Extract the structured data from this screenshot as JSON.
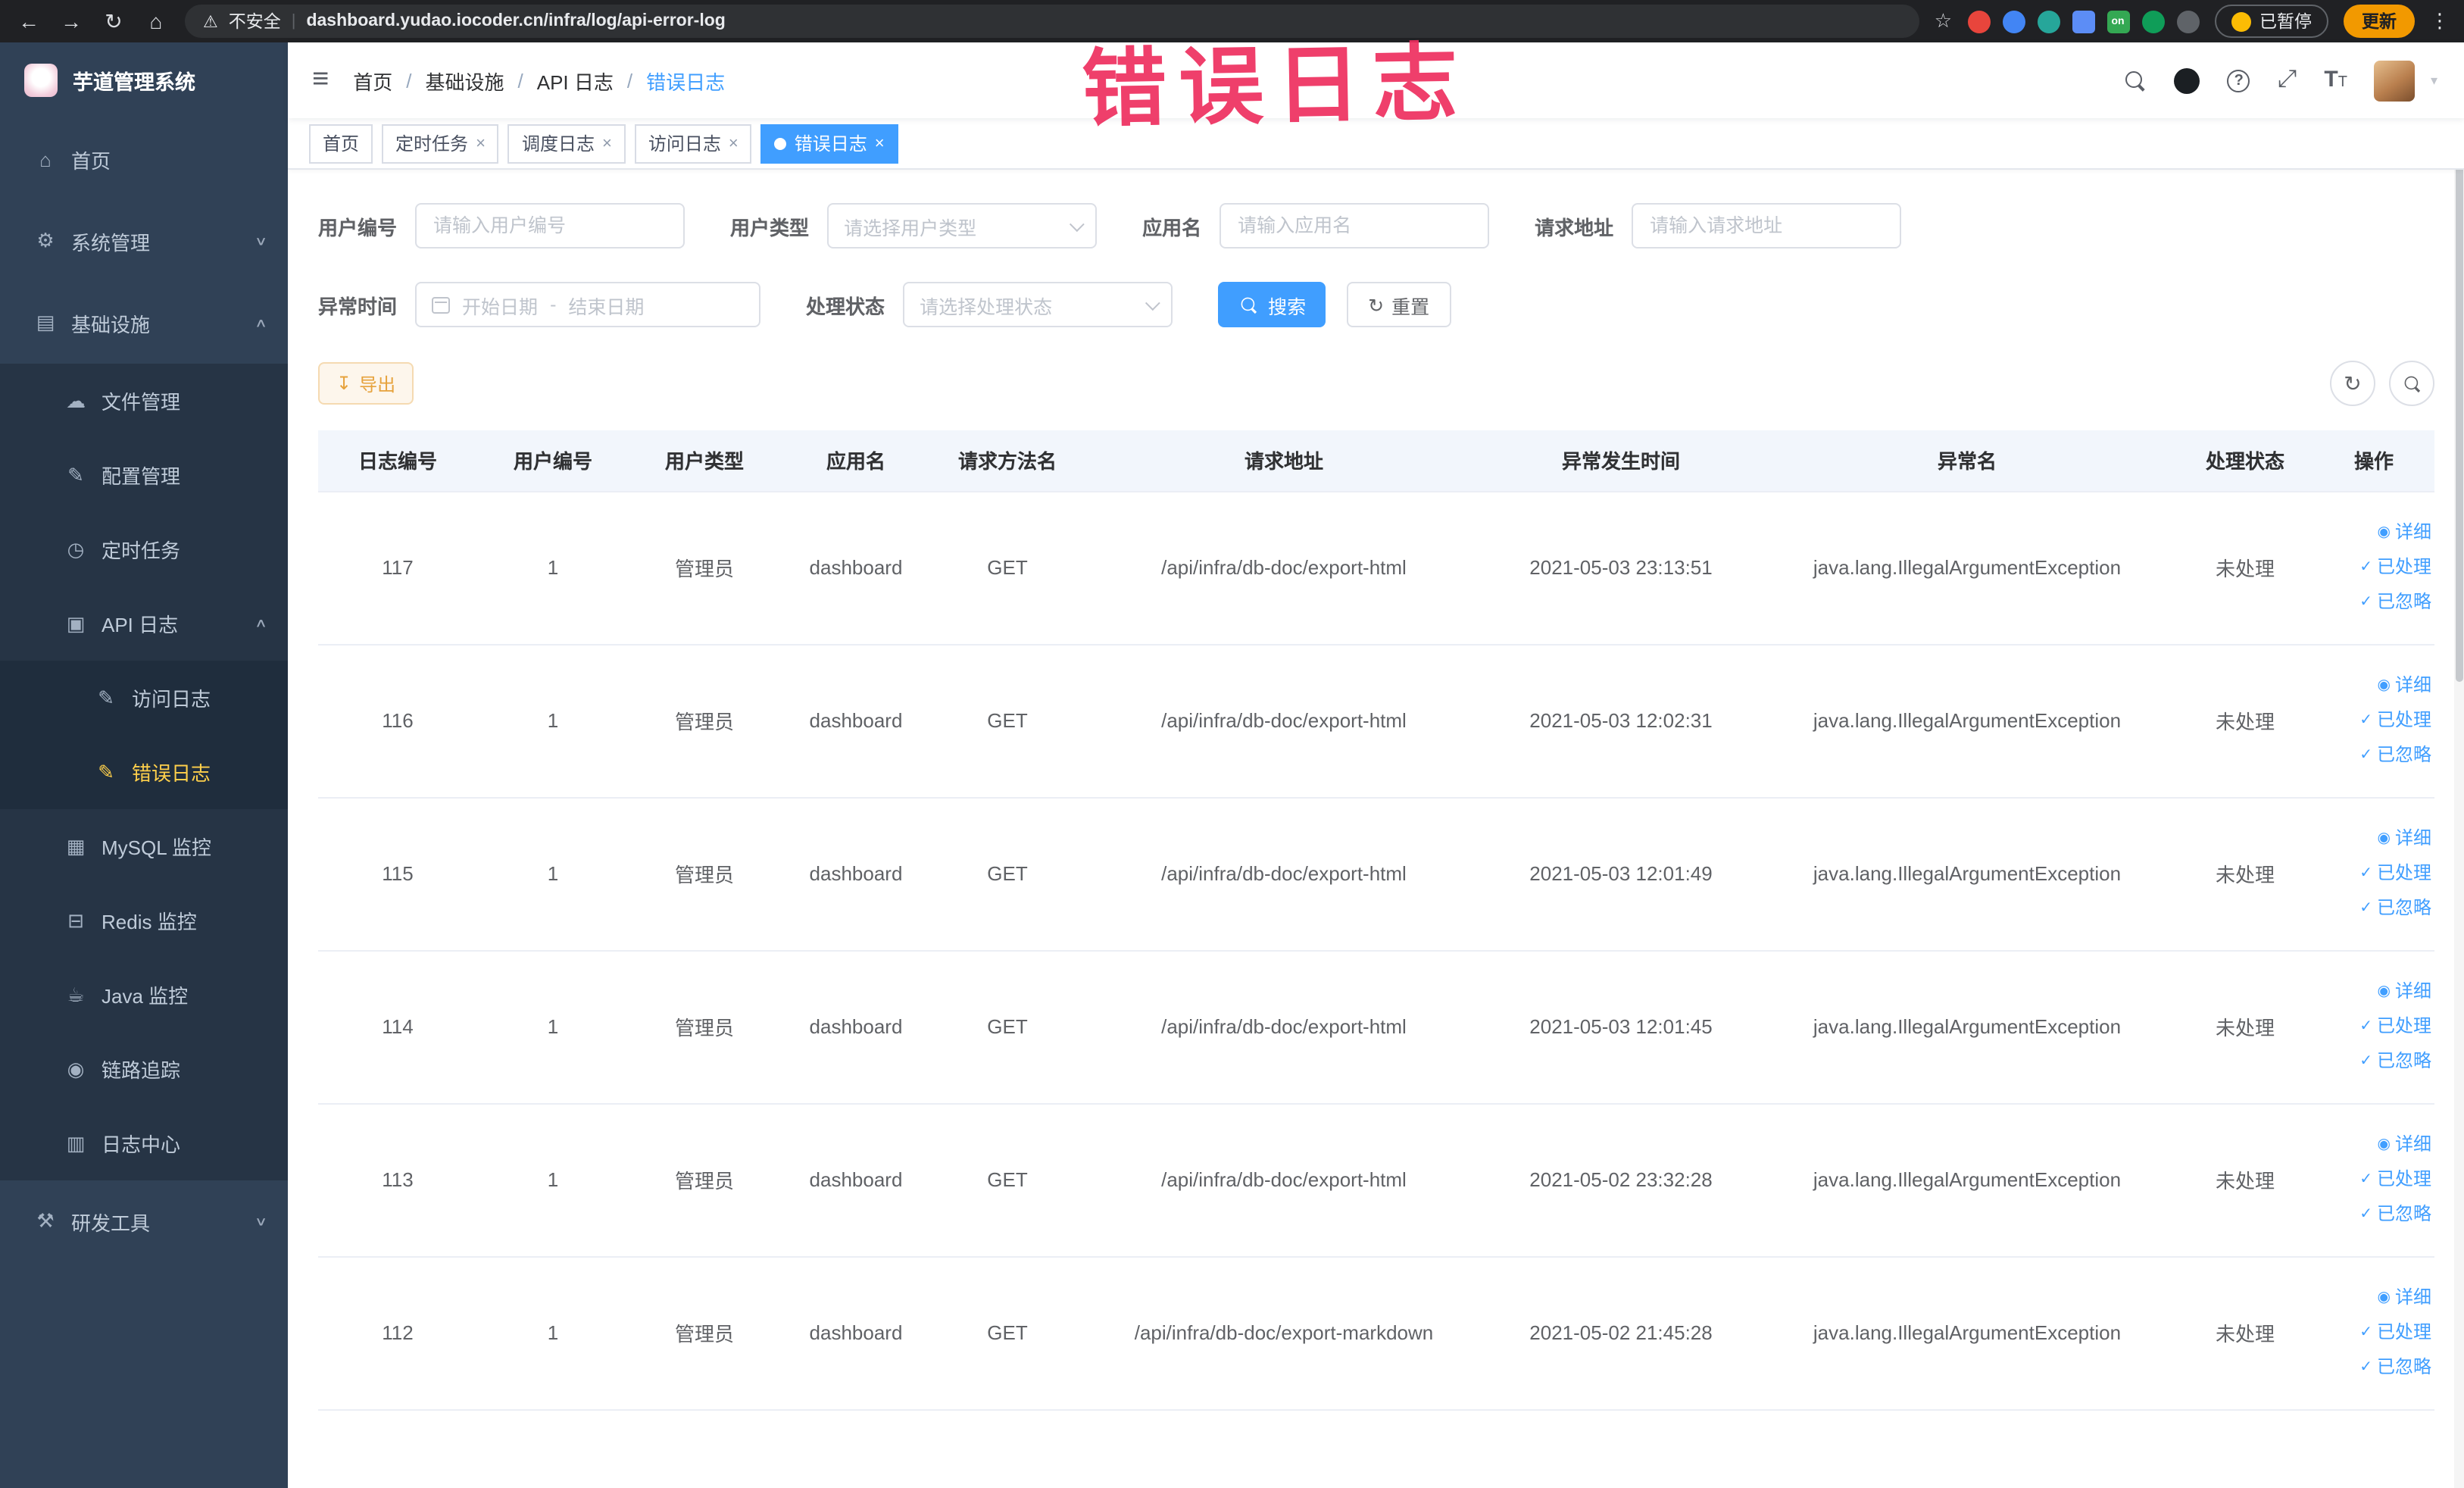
{
  "browser": {
    "security_label": "不安全",
    "url": "dashboard.yudao.iocoder.cn/infra/log/api-error-log",
    "ext_on_badge": "on",
    "paused_button": "已暂停",
    "update_button": "更新"
  },
  "annotation": "错误日志",
  "sidebar": {
    "title": "芋道管理系统",
    "items": [
      {
        "label": "首页"
      },
      {
        "label": "系统管理"
      },
      {
        "label": "基础设施"
      },
      {
        "label": "文件管理"
      },
      {
        "label": "配置管理"
      },
      {
        "label": "定时任务"
      },
      {
        "label": "API 日志"
      },
      {
        "label": "访问日志"
      },
      {
        "label": "错误日志"
      },
      {
        "label": "MySQL 监控"
      },
      {
        "label": "Redis 监控"
      },
      {
        "label": "Java 监控"
      },
      {
        "label": "链路追踪"
      },
      {
        "label": "日志中心"
      },
      {
        "label": "研发工具"
      }
    ]
  },
  "breadcrumb": [
    "首页",
    "基础设施",
    "API 日志",
    "错误日志"
  ],
  "tabs": [
    {
      "label": "首页"
    },
    {
      "label": "定时任务"
    },
    {
      "label": "调度日志"
    },
    {
      "label": "访问日志"
    },
    {
      "label": "错误日志"
    }
  ],
  "filters": {
    "user_id_label": "用户编号",
    "user_id_placeholder": "请输入用户编号",
    "user_type_label": "用户类型",
    "user_type_placeholder": "请选择用户类型",
    "app_name_label": "应用名",
    "app_name_placeholder": "请输入应用名",
    "request_url_label": "请求地址",
    "request_url_placeholder": "请输入请求地址",
    "exception_time_label": "异常时间",
    "date_start_placeholder": "开始日期",
    "date_separator": "-",
    "date_end_placeholder": "结束日期",
    "process_status_label": "处理状态",
    "process_status_placeholder": "请选择处理状态",
    "search_button": "搜索",
    "reset_button": "重置"
  },
  "toolbar": {
    "export_button": "导出"
  },
  "table": {
    "columns": [
      "日志编号",
      "用户编号",
      "用户类型",
      "应用名",
      "请求方法名",
      "请求地址",
      "异常发生时间",
      "异常名",
      "处理状态",
      "操作"
    ],
    "actions": {
      "detail": "详细",
      "processed": "已处理",
      "ignored": "已忽略"
    },
    "rows": [
      {
        "log_id": "117",
        "user_id": "1",
        "user_type": "管理员",
        "app": "dashboard",
        "method": "GET",
        "url": "/api/infra/db-doc/export-html",
        "time": "2021-05-03 23:13:51",
        "exception": "java.lang.IllegalArgumentException",
        "status": "未处理"
      },
      {
        "log_id": "116",
        "user_id": "1",
        "user_type": "管理员",
        "app": "dashboard",
        "method": "GET",
        "url": "/api/infra/db-doc/export-html",
        "time": "2021-05-03 12:02:31",
        "exception": "java.lang.IllegalArgumentException",
        "status": "未处理"
      },
      {
        "log_id": "115",
        "user_id": "1",
        "user_type": "管理员",
        "app": "dashboard",
        "method": "GET",
        "url": "/api/infra/db-doc/export-html",
        "time": "2021-05-03 12:01:49",
        "exception": "java.lang.IllegalArgumentException",
        "status": "未处理"
      },
      {
        "log_id": "114",
        "user_id": "1",
        "user_type": "管理员",
        "app": "dashboard",
        "method": "GET",
        "url": "/api/infra/db-doc/export-html",
        "time": "2021-05-03 12:01:45",
        "exception": "java.lang.IllegalArgumentException",
        "status": "未处理"
      },
      {
        "log_id": "113",
        "user_id": "1",
        "user_type": "管理员",
        "app": "dashboard",
        "method": "GET",
        "url": "/api/infra/db-doc/export-html",
        "time": "2021-05-02 23:32:28",
        "exception": "java.lang.IllegalArgumentException",
        "status": "未处理"
      },
      {
        "log_id": "112",
        "user_id": "1",
        "user_type": "管理员",
        "app": "dashboard",
        "method": "GET",
        "url": "/api/infra/db-doc/export-markdown",
        "time": "2021-05-02 21:45:28",
        "exception": "java.lang.IllegalArgumentException",
        "status": "未处理"
      }
    ]
  },
  "colors": {
    "accent": "#409eff",
    "sidebar_bg": "#304156",
    "sidebar_active": "#ffd04b",
    "warning": "#e6a23c",
    "annotation": "#ee2f5f"
  },
  "icons": {
    "back": "←",
    "forward": "→",
    "reload": "↻",
    "home": "⌂",
    "warning": "⚠",
    "star": "☆",
    "kebab": "⋮",
    "hamburger": "≡",
    "gear": "⚙",
    "infra": "▤",
    "file": "☁",
    "config": "✎",
    "timer": "◷",
    "apilog": "▣",
    "doc": "✎",
    "mysql": "▦",
    "redis": "⊟",
    "java": "☕",
    "trace": "◉",
    "logcenter": "▥",
    "tools": "⚒",
    "chevron_down": "∨",
    "chevron_up": "∧",
    "close": "×",
    "download": "↧",
    "refresh": "↻",
    "check": "✓",
    "eye": "◉",
    "fullscreen": "⤢",
    "font_large": "T",
    "font_small": "T",
    "question": "?",
    "caret": "▾",
    "url_sep": "|"
  }
}
